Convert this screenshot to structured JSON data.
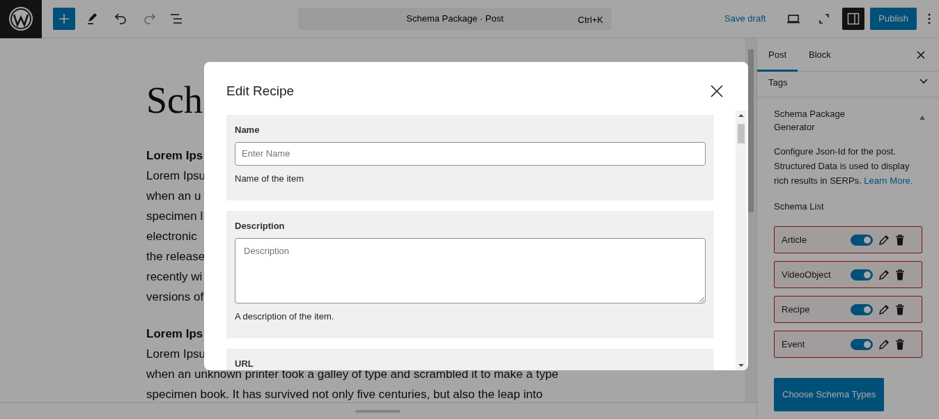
{
  "topbar": {
    "document_title": "Schema Package · Post",
    "shortcut": "Ctrl+K",
    "save_draft": "Save draft",
    "publish": "Publish"
  },
  "editor": {
    "title": "Sch",
    "blocks": [
      {
        "kind": "heading",
        "text": "Lorem Ips"
      },
      {
        "kind": "paragraph",
        "lines": [
          "Lorem Ipsu",
          "when an u",
          "specimen l",
          "electronic",
          "the release",
          "recently wi",
          "versions of"
        ]
      },
      {
        "kind": "heading",
        "text": "Lorem Ips"
      },
      {
        "kind": "paragraph",
        "lines": [
          "Lorem Ipsu",
          "when an unknown printer took a galley of type and scrambled it to make a type",
          "specimen book. It has survived not only five centuries, but also the leap into"
        ]
      }
    ]
  },
  "sidebar": {
    "tabs": [
      {
        "label": "Post",
        "selected": true
      },
      {
        "label": "Block",
        "selected": false
      }
    ],
    "panels": [
      {
        "title": "Tags",
        "expanded": false
      },
      {
        "title": "Schema Package Generator",
        "expanded": true
      }
    ],
    "description": "Configure Json-Id for the post. Structured Data is used to display rich results in SERPs.",
    "learn_more": "Learn More.",
    "schema_list_title": "Schema List",
    "schemas": [
      {
        "name": "Article",
        "on": true
      },
      {
        "name": "VideoObject",
        "on": true
      },
      {
        "name": "Recipe",
        "on": true
      },
      {
        "name": "Event",
        "on": true
      }
    ],
    "choose_button": "Choose Schema Types"
  },
  "modal": {
    "title": "Edit Recipe",
    "fields": [
      {
        "kind": "input",
        "label": "Name",
        "placeholder": "Enter Name",
        "help": "Name of the item"
      },
      {
        "kind": "textarea",
        "label": "Description",
        "placeholder": "Description",
        "help": "A description of the item."
      },
      {
        "label": "URL"
      }
    ]
  }
}
